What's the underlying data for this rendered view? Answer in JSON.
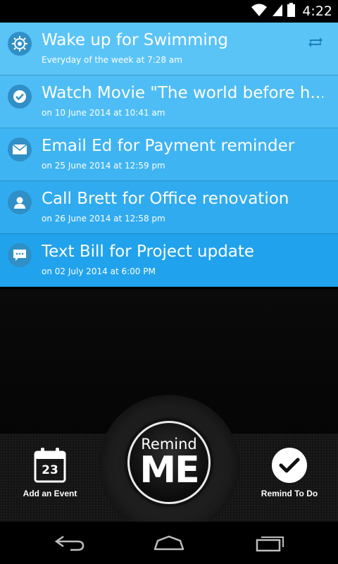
{
  "status_bar": {
    "time": "4:22"
  },
  "reminders": [
    {
      "title": "Wake up for Swimming",
      "subtitle": "Everyday of the week at 7:28 am",
      "icon": "alarm-icon",
      "repeating": true,
      "bg": "#5bc4f7"
    },
    {
      "title": "Watch Movie \"The world before h...",
      "subtitle": "on 10 June 2014 at 10:41 am",
      "icon": "checkmark-icon",
      "repeating": false,
      "bg": "#4ebdf5"
    },
    {
      "title": "Email Ed for Payment reminder",
      "subtitle": "on 25 June 2014 at 12:59 pm",
      "icon": "email-icon",
      "repeating": false,
      "bg": "#3fb4f2"
    },
    {
      "title": "Call Brett for Office renovation",
      "subtitle": "on 26 June 2014 at 12:58 pm",
      "icon": "contact-icon",
      "repeating": false,
      "bg": "#30abef"
    },
    {
      "title": "Text Bill for Project update",
      "subtitle": "on 02 July 2014 at 6:00 PM",
      "icon": "message-icon",
      "repeating": false,
      "bg": "#21a2ec"
    }
  ],
  "bottom": {
    "add_event_label": "Add an Event",
    "calendar_day": "23",
    "remind_button_top": "Remind",
    "remind_button_main": "ME",
    "remind_todo_label": "Remind To Do"
  },
  "colors": {
    "icon_circle": "#2f8fc6",
    "list_divider": "#1c6a9a"
  }
}
